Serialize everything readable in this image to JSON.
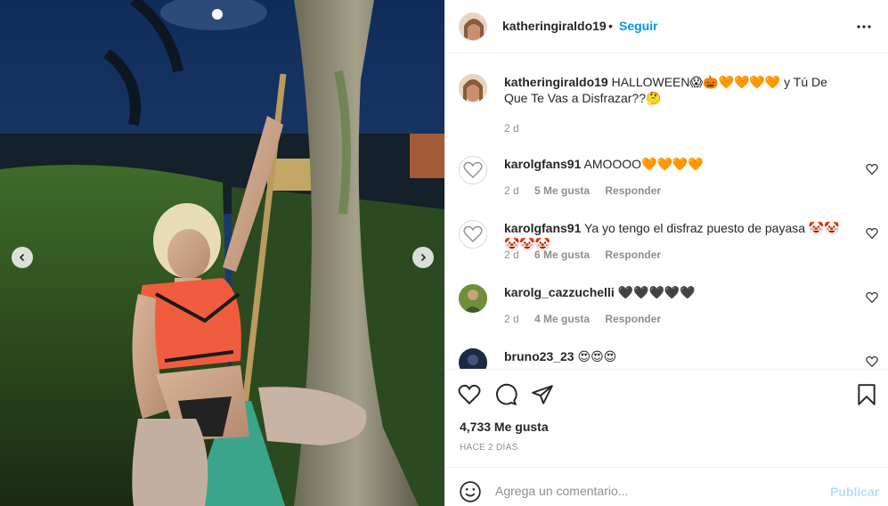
{
  "post": {
    "username": "katheringiraldo19",
    "separator": "•",
    "follow_label": "Seguir",
    "more_icon": "more-horizontal-icon"
  },
  "caption": {
    "username": "katheringiraldo19",
    "text": "HALLOWEEN😱🎃🧡🧡🧡🧡 y Tú De Que Te Vas a Disfrazar??🤔",
    "time": "2 d"
  },
  "comments": [
    {
      "username": "karolgfans91",
      "text": "AMOOOO🧡🧡🧡🧡",
      "time": "2 d",
      "likes": "5 Me gusta",
      "reply": "Responder",
      "avatar": "heart-outline-avatar"
    },
    {
      "username": "karolgfans91",
      "text": "Ya yo tengo el disfraz puesto de payasa 🤡🤡🤡🤡🤡",
      "time": "2 d",
      "likes": "6 Me gusta",
      "reply": "Responder",
      "avatar": "heart-outline-avatar"
    },
    {
      "username": "karolg_cazzuchelli",
      "text": "🖤🖤🖤🖤🖤",
      "time": "2 d",
      "likes": "4 Me gusta",
      "reply": "Responder",
      "avatar": "green-photo-avatar"
    },
    {
      "username": "bruno23_23",
      "text": "😍😍😍",
      "time": "",
      "likes": "",
      "reply": "",
      "avatar": "dark-photo-avatar"
    }
  ],
  "actions": {
    "like_icon": "heart-icon",
    "comment_icon": "comment-icon",
    "share_icon": "paper-plane-icon",
    "save_icon": "bookmark-icon"
  },
  "likes_text": "4,733 Me gusta",
  "posted_ago": "HACE 2 DÍAS",
  "composer": {
    "placeholder": "Agrega un comentario...",
    "publish_label": "Publicar"
  },
  "colors": {
    "accent": "#0095f6",
    "publish_disabled": "#b2dffc",
    "muted": "#8e8e8e",
    "text": "#262626"
  }
}
